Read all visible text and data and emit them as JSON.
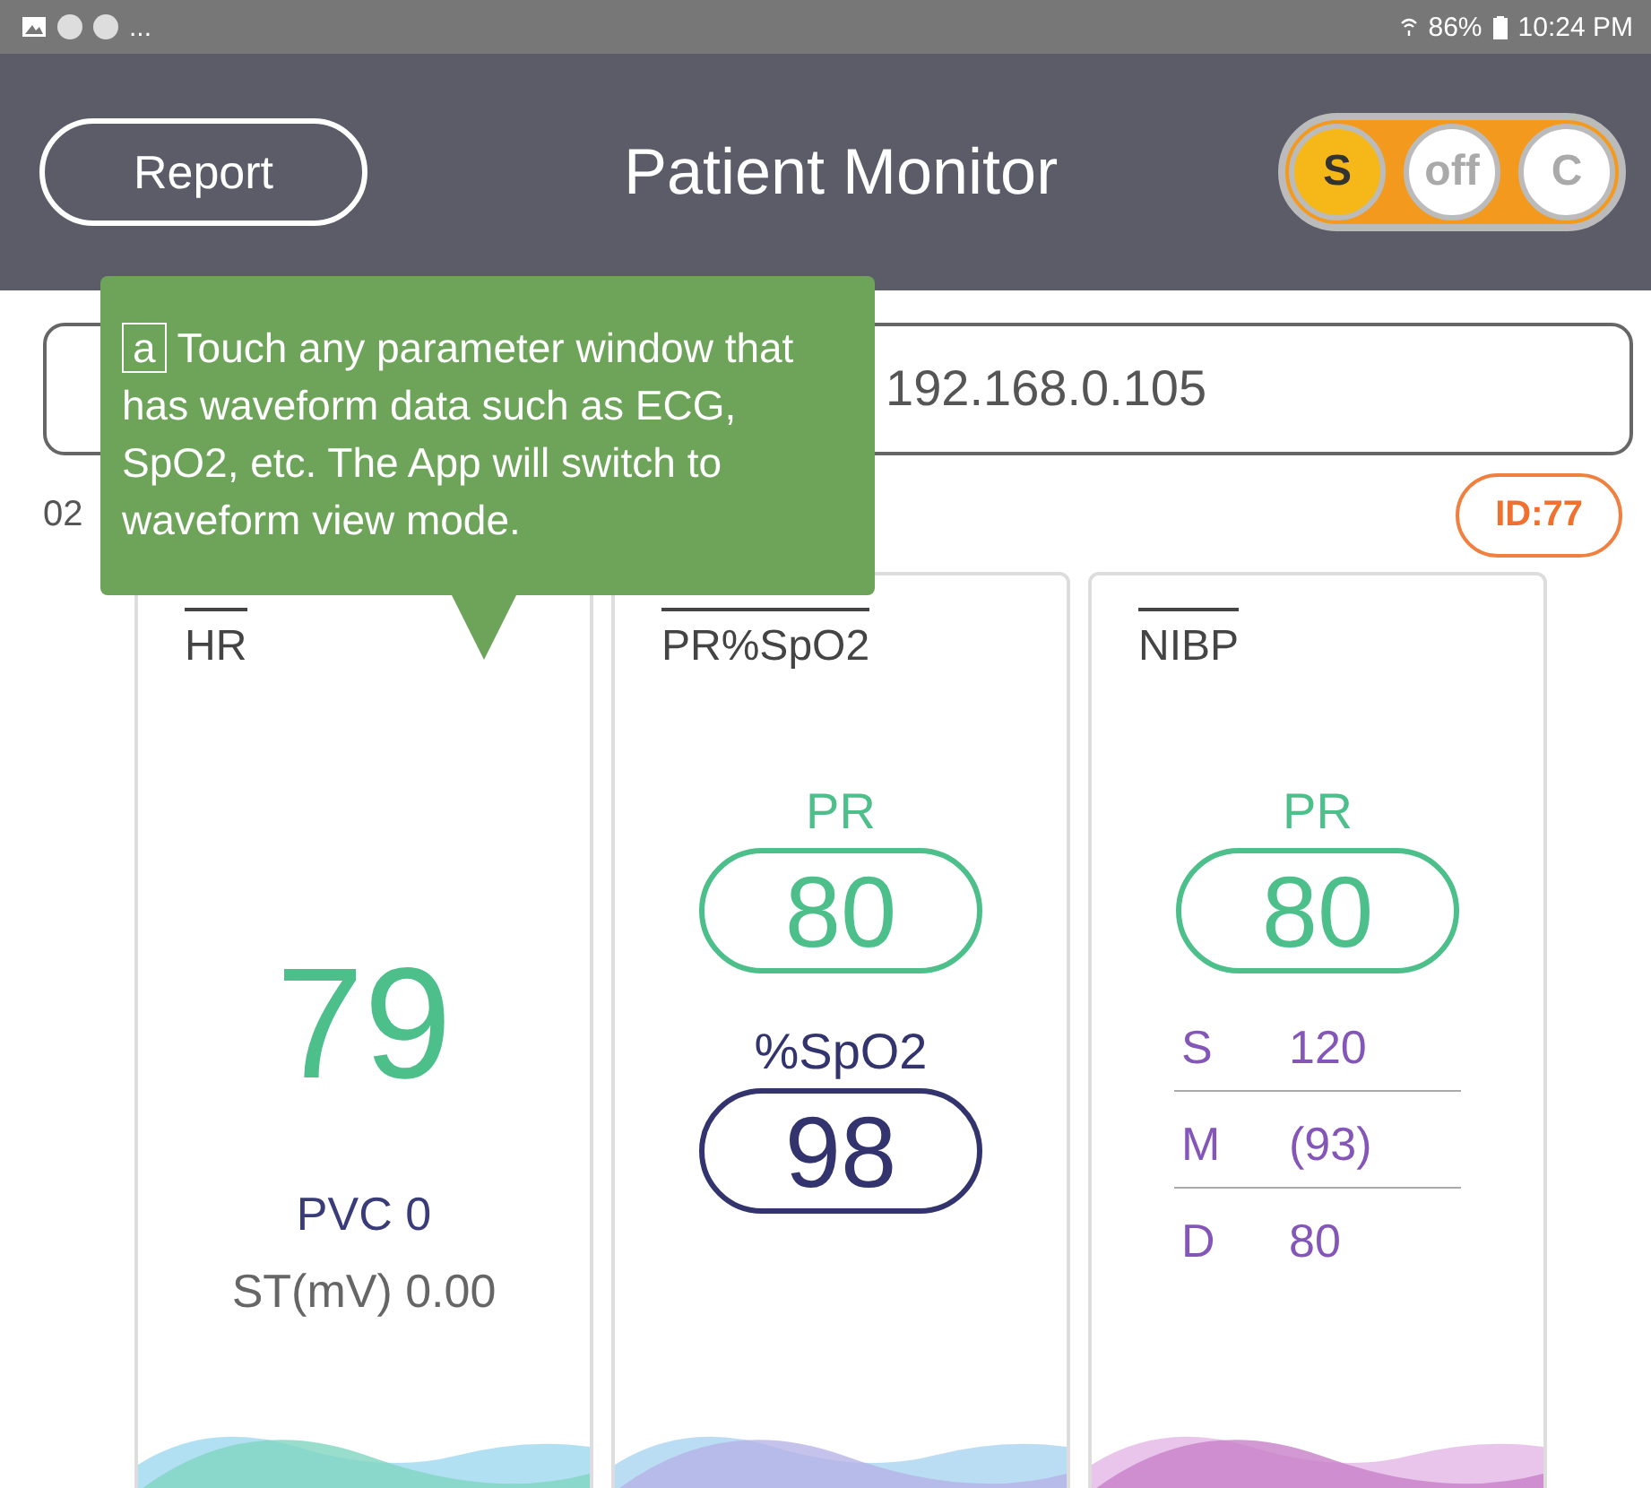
{
  "status_bar": {
    "more": "...",
    "battery": "86%",
    "time": "10:24 PM"
  },
  "header": {
    "report_button": "Report",
    "title": "Patient Monitor",
    "mode_switch": [
      {
        "label": "S",
        "selected": true
      },
      {
        "label": "off",
        "selected": false
      },
      {
        "label": "C",
        "selected": false
      }
    ]
  },
  "connection": {
    "address": "192.168.0.105"
  },
  "date": "02",
  "id_badge": "ID:77",
  "tooltip": {
    "marker": "a",
    "text": "Touch any parameter window that has waveform data such as ECG, SpO2, etc. The App will switch to waveform view mode."
  },
  "cards": [
    {
      "kind": "hr",
      "title": "HR",
      "value": "79",
      "pvc": "PVC 0",
      "st": "ST(mV) 0.00"
    },
    {
      "kind": "spo2",
      "title": "PR%SpO2",
      "pr_label": "PR",
      "pr_value": "80",
      "spo2_label": "%SpO2",
      "spo2_value": "98"
    },
    {
      "kind": "nibp",
      "title": "NIBP",
      "pr_label": "PR",
      "pr_value": "80",
      "readings": [
        {
          "label": "S",
          "value": "120"
        },
        {
          "label": "M",
          "value": "(93)"
        },
        {
          "label": "D",
          "value": "80"
        }
      ]
    }
  ]
}
